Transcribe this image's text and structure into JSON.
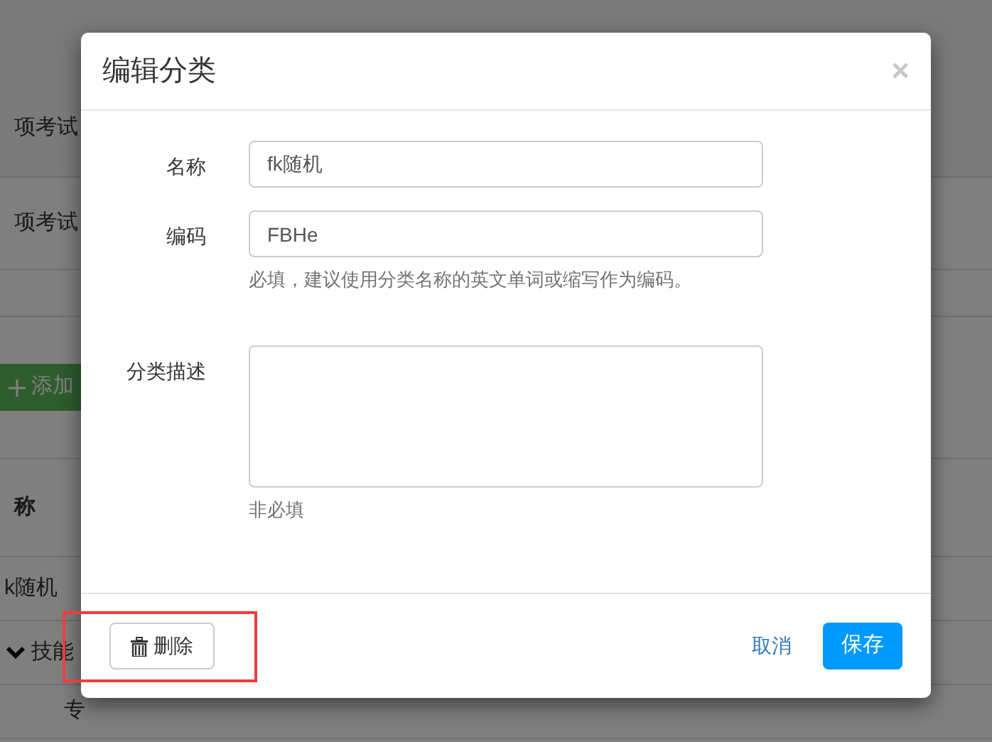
{
  "background_page": {
    "section_titles": [
      "项考试",
      "项考试"
    ],
    "add_button": "添加",
    "table": {
      "header": "称",
      "rows": [
        {
          "kind": "plain",
          "cells": [
            "k随机"
          ]
        },
        {
          "kind": "group",
          "expanded": true,
          "cells": [
            "技能"
          ]
        },
        {
          "kind": "child",
          "cells": [
            "专"
          ]
        }
      ]
    }
  },
  "dialog": {
    "title": "编辑分类",
    "close": "×",
    "fields": [
      {
        "kind": "input",
        "label": "名称",
        "value": "fk随机"
      },
      {
        "kind": "input",
        "label": "编码",
        "value": "FBHe",
        "help": "必填，建议使用分类名称的英文单词或缩写作为编码。"
      },
      {
        "kind": "textarea",
        "label": "分类描述",
        "help": "非必填"
      }
    ],
    "delete_button": "删除",
    "cancel_link": "取消",
    "save_button": "保存",
    "delete_highlighted": true
  }
}
